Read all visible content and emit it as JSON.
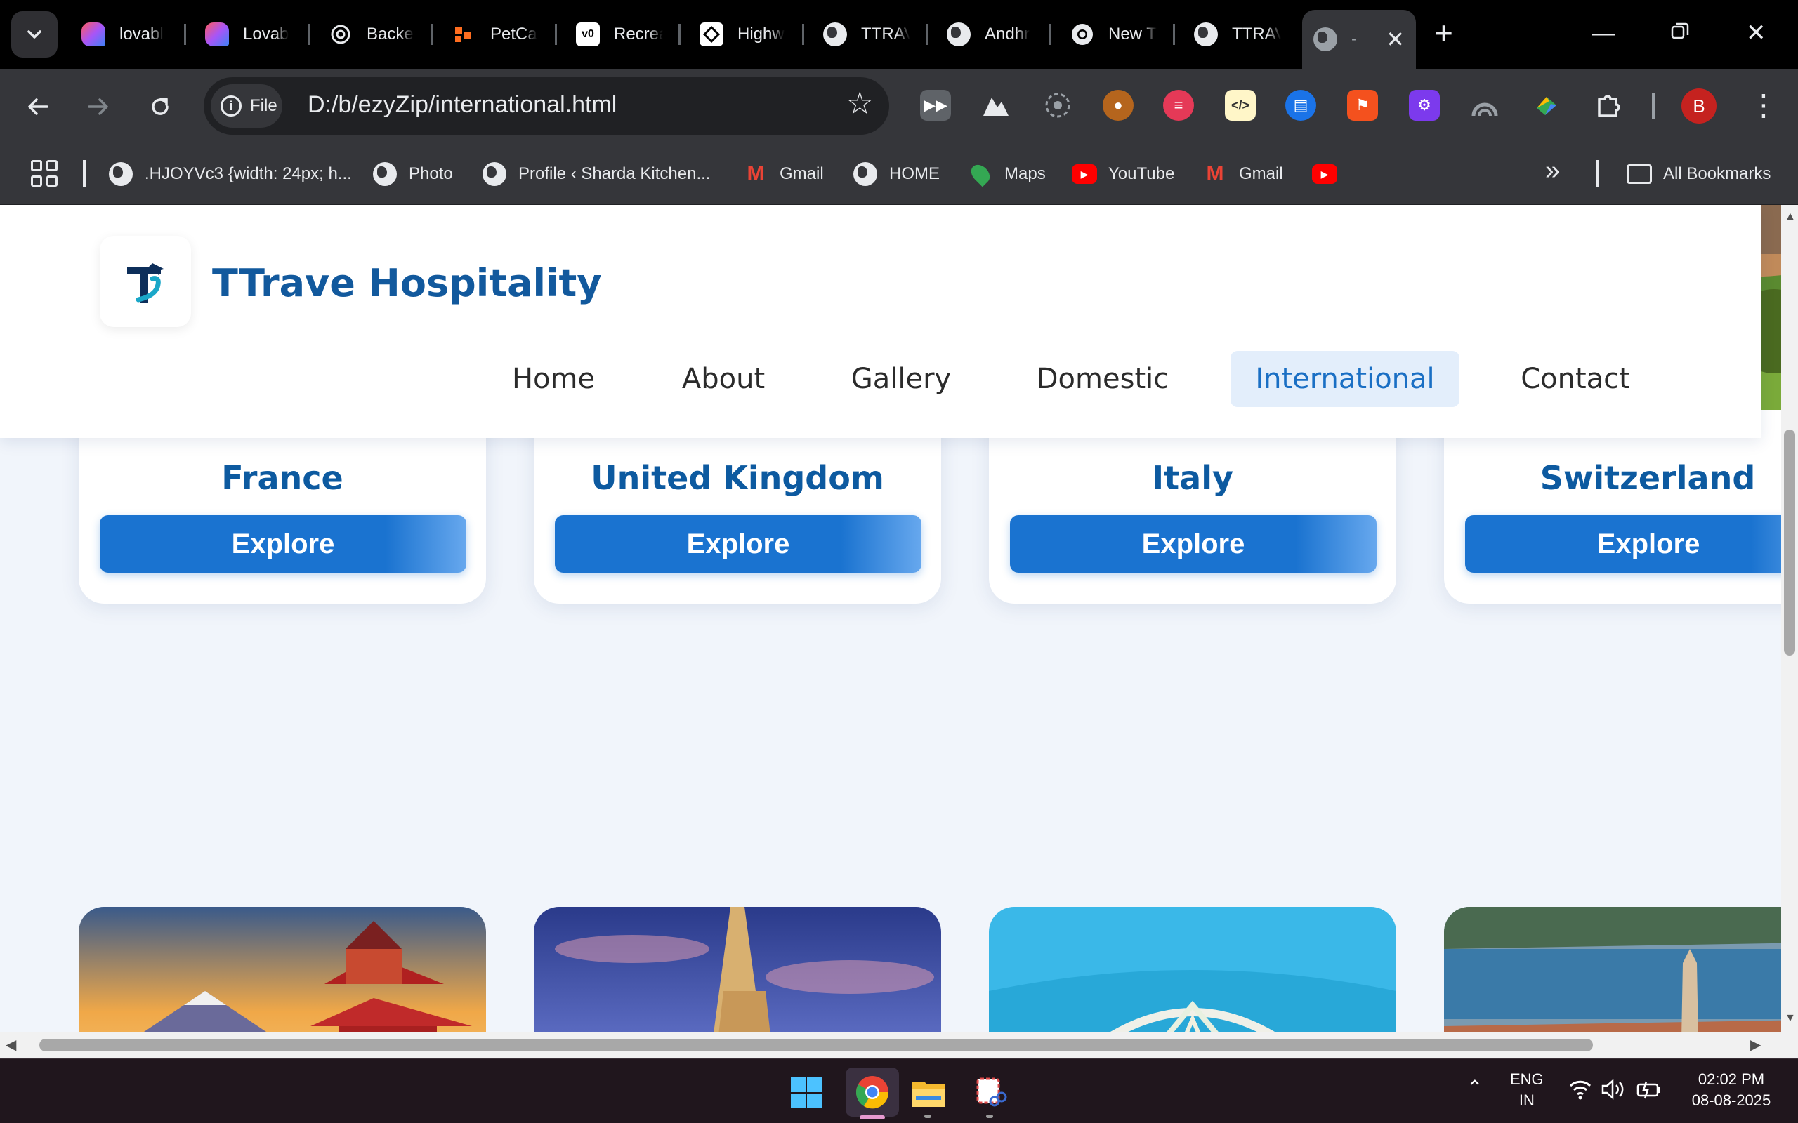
{
  "browser": {
    "tabs": [
      {
        "title": "lovabl",
        "icon": "lovable-icon"
      },
      {
        "title": "Lovab",
        "icon": "lovable-icon"
      },
      {
        "title": "Backe",
        "icon": "chatgpt-icon"
      },
      {
        "title": "PetCa",
        "icon": "petcare-icon"
      },
      {
        "title": "Recrea",
        "icon": "v0-icon"
      },
      {
        "title": "Highw",
        "icon": "highway-icon"
      },
      {
        "title": "TTRAV",
        "icon": "globe-icon"
      },
      {
        "title": "Andhr",
        "icon": "globe-icon"
      },
      {
        "title": "New T",
        "icon": "chrome-icon"
      },
      {
        "title": "TTRAV",
        "icon": "globe-icon"
      },
      {
        "title": "-",
        "icon": "globe-icon",
        "active": true
      }
    ],
    "address_chip": "File",
    "url": "D:/b/ezyZip/international.html",
    "profile_initial": "B",
    "bookmarks": [
      {
        "label": ".HJOYVc3 {width: 24px; h...",
        "icon": "globe-icon"
      },
      {
        "label": "Photo",
        "icon": "globe-icon"
      },
      {
        "label": "Profile ‹ Sharda Kitchen...",
        "icon": "globe-icon"
      },
      {
        "label": "Gmail",
        "icon": "gmail-icon"
      },
      {
        "label": "HOME",
        "icon": "globe-icon"
      },
      {
        "label": "Maps",
        "icon": "maps-icon"
      },
      {
        "label": "YouTube",
        "icon": "youtube-icon"
      },
      {
        "label": "Gmail",
        "icon": "gmail-icon"
      }
    ],
    "all_bookmarks": "All Bookmarks"
  },
  "site": {
    "brand": "TTrave Hospitality",
    "nav": [
      "Home",
      "About",
      "Gallery",
      "Domestic",
      "International",
      "Contact"
    ],
    "active_nav": "International",
    "cards_row1": [
      {
        "name": "France",
        "button": "Explore"
      },
      {
        "name": "United Kingdom",
        "button": "Explore"
      },
      {
        "name": "Italy",
        "button": "Explore"
      },
      {
        "name": "Switzerland",
        "button": "Explore"
      }
    ]
  },
  "taskbar": {
    "lang_line1": "ENG",
    "lang_line2": "IN",
    "time": "02:02 PM",
    "date": "08-08-2025"
  },
  "colors": {
    "brand": "#12599d",
    "accent": "#1a73d0",
    "nav_active_bg": "#e3eefb"
  }
}
